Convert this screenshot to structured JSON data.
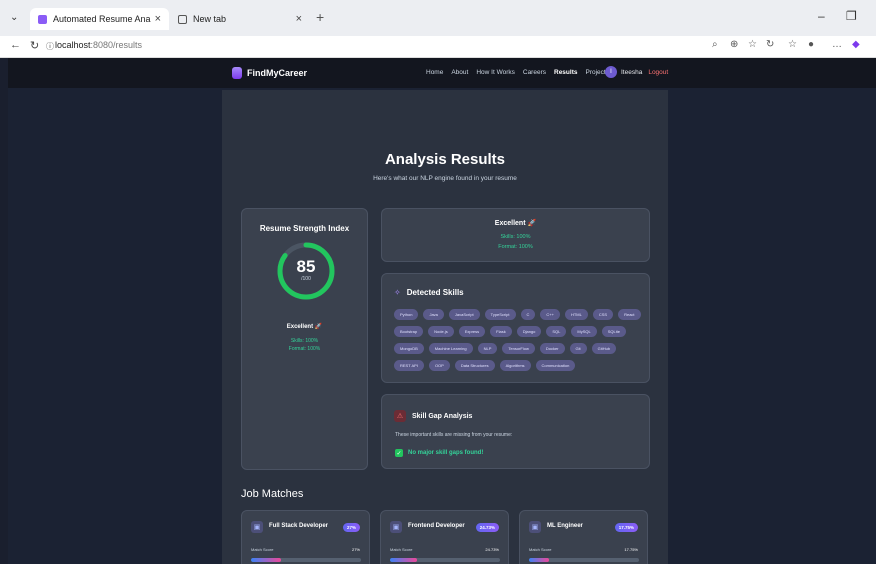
{
  "browser": {
    "tabs": [
      {
        "label": "Automated Resume Analysis & Sk",
        "close": "×"
      },
      {
        "label": "New tab",
        "close": "×"
      }
    ],
    "new_tab": "+",
    "url_host": "localhost",
    "url_path": ":8080/results",
    "window": {
      "minimize": "–",
      "restore": "❐"
    }
  },
  "app": {
    "brand": "FindMyCareer",
    "nav": [
      "Home",
      "About",
      "How It Works",
      "Careers",
      "Results",
      "Projects"
    ],
    "active_nav": "Results",
    "user_initial": "I",
    "user_name": "Iteesha",
    "logout": "Logout"
  },
  "header": {
    "title": "Analysis Results",
    "subtitle": "Here's what our NLP engine found in your resume"
  },
  "strength": {
    "title": "Resume Strength Index",
    "score": "85",
    "max": "/100",
    "score_value": 85,
    "grade": "Excellent 🚀",
    "skills": "Skills: 100%",
    "format": "Format: 100%"
  },
  "summary": {
    "grade": "Excellent 🚀",
    "skills": "Skills: 100%",
    "format": "Format: 100%"
  },
  "skills": {
    "title": "Detected Skills",
    "items": [
      "Python",
      "Java",
      "JavaScript",
      "TypeScript",
      "C",
      "C++",
      "HTML",
      "CSS",
      "React",
      "Bootstrap",
      "Node.js",
      "Express",
      "Flask",
      "Django",
      "SQL",
      "MySQL",
      "SQLite",
      "MongoDB",
      "Machine Learning",
      "NLP",
      "TensorFlow",
      "Docker",
      "Git",
      "GitHub",
      "REST API",
      "OOP",
      "Data Structures",
      "Algorithms",
      "Communication"
    ]
  },
  "gap": {
    "title": "Skill Gap Analysis",
    "desc": "These important skills are missing from your resume:",
    "ok": "No major skill gaps found!"
  },
  "jobs": {
    "title": "Job Matches",
    "match_label": "Match Score",
    "items": [
      {
        "name": "Full Stack Developer",
        "badge": "27%",
        "pct": "27%",
        "value": 27
      },
      {
        "name": "Frontend Developer",
        "badge": "24.73%",
        "pct": "24.73%",
        "value": 24.73
      },
      {
        "name": "ML Engineer",
        "badge": "17.75%",
        "pct": "17.75%",
        "value": 17.75
      }
    ]
  },
  "colors": {
    "accent": "#7c3aed",
    "success": "#22c55e",
    "bg": "#1b2233",
    "card": "#3a414e"
  }
}
